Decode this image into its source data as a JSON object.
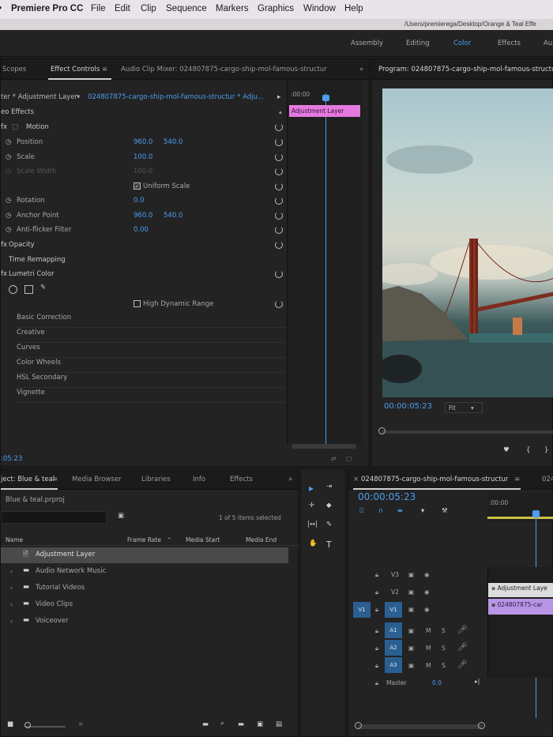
{
  "menubar": {
    "app": "Premiere Pro CC",
    "items": [
      "File",
      "Edit",
      "Clip",
      "Sequence",
      "Markers",
      "Graphics",
      "Window",
      "Help"
    ]
  },
  "titlebar": {
    "path": "/Users/premierega/Desktop/Orange & Teal Effe"
  },
  "workspaces": [
    "Assembly",
    "Editing",
    "Color",
    "Effects",
    "Au"
  ],
  "active_workspace": "Color",
  "effect_panel": {
    "tabs": [
      "Scopes",
      "Effect Controls",
      "Audio Clip Mixer: 024807875-cargo-ship-mol-famous-structur"
    ],
    "source_label": "ter * Adjustment Layer",
    "sequence_label": "024807875-cargo-ship-mol-famous-structur * Adju...",
    "section": "eo Effects",
    "motion": "Motion",
    "position": {
      "label": "Position",
      "x": "960.0",
      "y": "540.0"
    },
    "scale": {
      "label": "Scale",
      "value": "100.0"
    },
    "scale_width": {
      "label": "Scale Width",
      "value": "100.0"
    },
    "uniform_scale": "Uniform Scale",
    "rotation": {
      "label": "Rotation",
      "value": "0.0"
    },
    "anchor": {
      "label": "Anchor Point",
      "x": "960.0",
      "y": "540.0"
    },
    "antiflicker": {
      "label": "Anti-flicker Filter",
      "value": "0.00"
    },
    "opacity": "Opacity",
    "remap": "Time Remapping",
    "lumetri": "Lumetri Color",
    "hdr": "High Dynamic Range",
    "lumetri_sections": [
      "Basic Correction",
      "Creative",
      "Curves",
      "Color Wheels",
      "HSL Secondary",
      "Vignette"
    ],
    "timecode": ":05:23",
    "mini_timeline_time": ":00:00",
    "mini_clip": "Adjustment Layer"
  },
  "program_monitor": {
    "title": "Program: 024807875-cargo-ship-mol-famous-structur",
    "timecode": "00:00:05:23",
    "fit": "Fit"
  },
  "project_panel": {
    "tabs": [
      "ject: Blue & teal",
      "Media Browser",
      "Libraries",
      "Info",
      "Effects"
    ],
    "project_file": "Blue & teal.prproj",
    "selected_count": "1 of 5 items selected",
    "columns": [
      "Name",
      "Frame Rate",
      "Media Start",
      "Media End"
    ],
    "items": [
      "Adjustment Layer",
      "Audio Network Music",
      "Tutorial Videos",
      "Video Clips",
      "Voiceover"
    ]
  },
  "timeline": {
    "tab": "024807875-cargo-ship-mol-famous-structur",
    "tab2": "024",
    "timecode": "00:00:05:23",
    "ruler_start": ":00:00",
    "tracks": [
      "V3",
      "V2",
      "V1",
      "A1",
      "A2",
      "A3"
    ],
    "source_patch": "V1",
    "master": "Master",
    "master_value": "0.0",
    "clip_v2": "Adjustment Laye",
    "clip_v1": "024807875-car"
  },
  "colors": {
    "accent_blue": "#4d9cf0",
    "clip_pink": "#e47ae0",
    "clip_violet": "#b895e6"
  }
}
